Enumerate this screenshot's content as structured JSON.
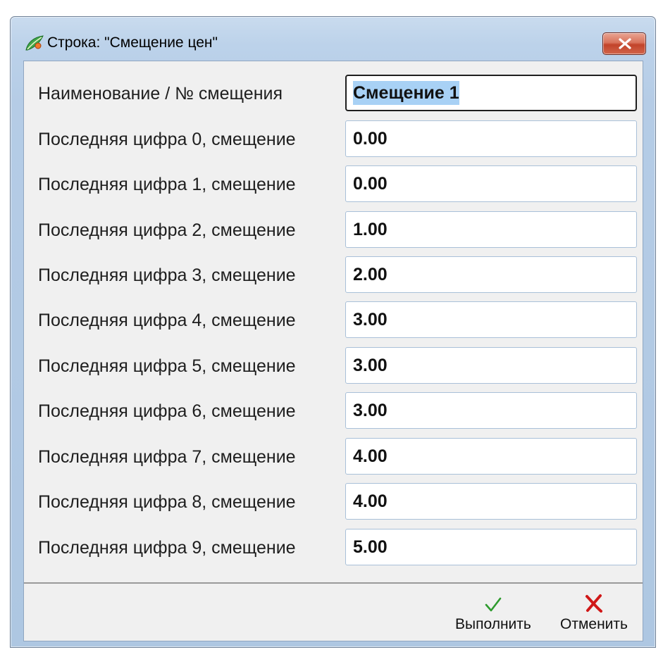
{
  "window": {
    "title": "Строка: \"Смещение цен\""
  },
  "form": {
    "name_label": "Наименование / № смещения",
    "name_value": "Смещение 1",
    "rows": [
      {
        "label": "Последняя цифра 0, смещение",
        "value": "0.00"
      },
      {
        "label": "Последняя цифра 1, смещение",
        "value": "0.00"
      },
      {
        "label": "Последняя цифра 2, смещение",
        "value": "1.00"
      },
      {
        "label": "Последняя цифра 3, смещение",
        "value": "2.00"
      },
      {
        "label": "Последняя цифра 4, смещение",
        "value": "3.00"
      },
      {
        "label": "Последняя цифра 5, смещение",
        "value": "3.00"
      },
      {
        "label": "Последняя цифра 6, смещение",
        "value": "3.00"
      },
      {
        "label": "Последняя цифра 7, смещение",
        "value": "4.00"
      },
      {
        "label": "Последняя цифра 8, смещение",
        "value": "4.00"
      },
      {
        "label": "Последняя цифра 9, смещение",
        "value": "5.00"
      }
    ]
  },
  "footer": {
    "execute_label": "Выполнить",
    "cancel_label": "Отменить"
  },
  "icons": {
    "app": "app-leaf-icon",
    "close": "close-icon",
    "execute": "checkmark-icon",
    "cancel": "cross-icon"
  },
  "colors": {
    "window_frame": "#b5cce6",
    "client_bg": "#f0f0f0",
    "close_button": "#c2432a",
    "checkmark": "#2e9b2e",
    "cross": "#d01818",
    "selection": "#a8d1f5"
  }
}
